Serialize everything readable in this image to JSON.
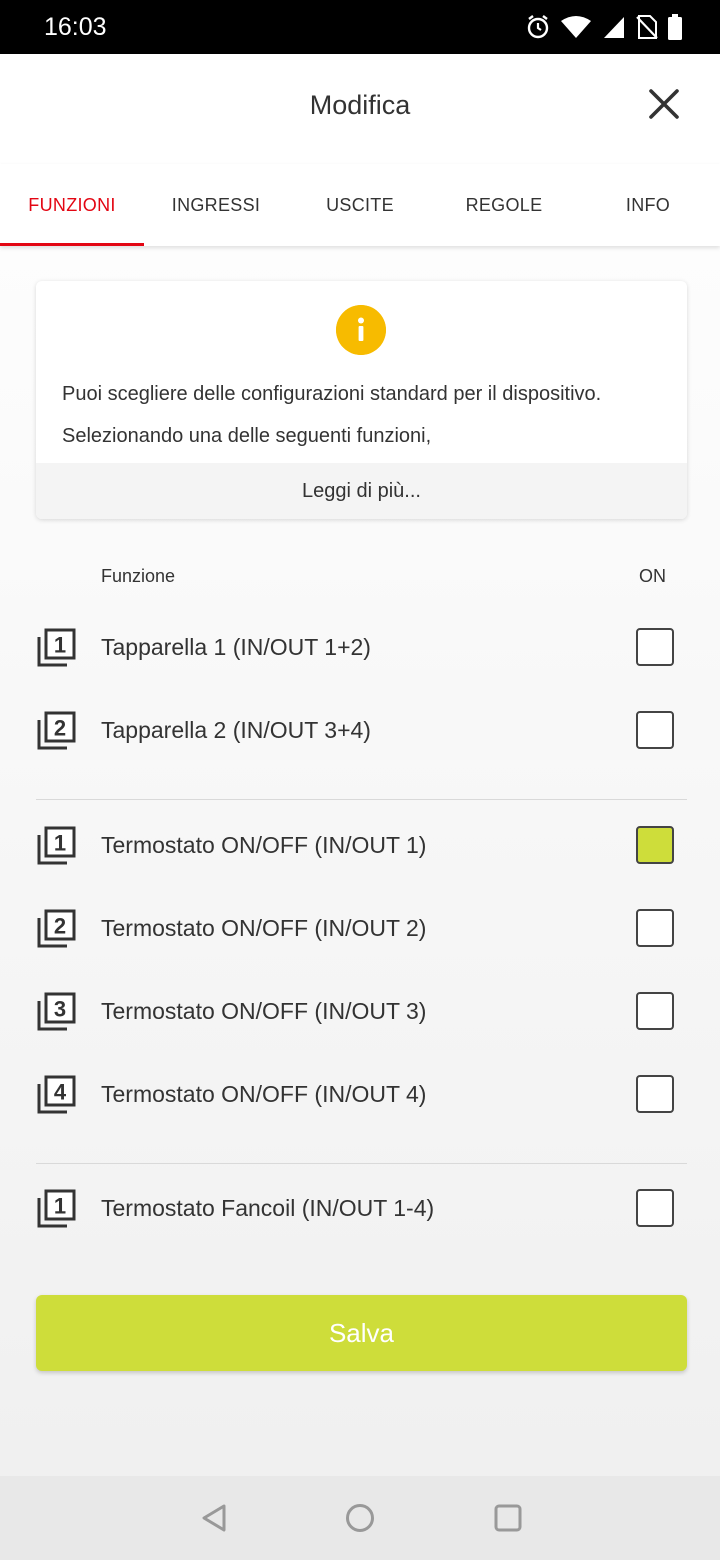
{
  "status_bar": {
    "time": "16:03",
    "icons": [
      "alarm-icon",
      "wifi-icon",
      "signal-icon",
      "no-sim-icon",
      "battery-icon"
    ]
  },
  "app_bar": {
    "title": "Modifica",
    "close_icon": "close-icon"
  },
  "tabs": [
    {
      "label": "FUNZIONI",
      "active": true
    },
    {
      "label": "INGRESSI",
      "active": false
    },
    {
      "label": "USCITE",
      "active": false
    },
    {
      "label": "REGOLE",
      "active": false
    },
    {
      "label": "INFO",
      "active": false
    }
  ],
  "info_card": {
    "icon": "info-icon",
    "text": "Puoi scegliere delle configurazioni standard per il dispositivo. Selezionando una delle seguenti funzioni,",
    "more_label": "Leggi di più..."
  },
  "list_header": {
    "function": "Funzione",
    "on": "ON"
  },
  "functions": [
    {
      "badge": "1",
      "label": "Tapparella 1 (IN/OUT 1+2)",
      "checked": false
    },
    {
      "badge": "2",
      "label": "Tapparella 2 (IN/OUT 3+4)",
      "checked": false
    },
    {
      "badge": "1",
      "label": "Termostato ON/OFF (IN/OUT 1)",
      "checked": true
    },
    {
      "badge": "2",
      "label": "Termostato ON/OFF (IN/OUT 2)",
      "checked": false
    },
    {
      "badge": "3",
      "label": "Termostato ON/OFF (IN/OUT 3)",
      "checked": false
    },
    {
      "badge": "4",
      "label": "Termostato ON/OFF (IN/OUT 4)",
      "checked": false
    },
    {
      "badge": "1",
      "label": "Termostato Fancoil (IN/OUT 1-4)",
      "checked": false
    }
  ],
  "save_label": "Salva",
  "colors": {
    "accent_red": "#e30613",
    "accent_lime": "#cedd3a",
    "info_yellow": "#f7bb00"
  }
}
